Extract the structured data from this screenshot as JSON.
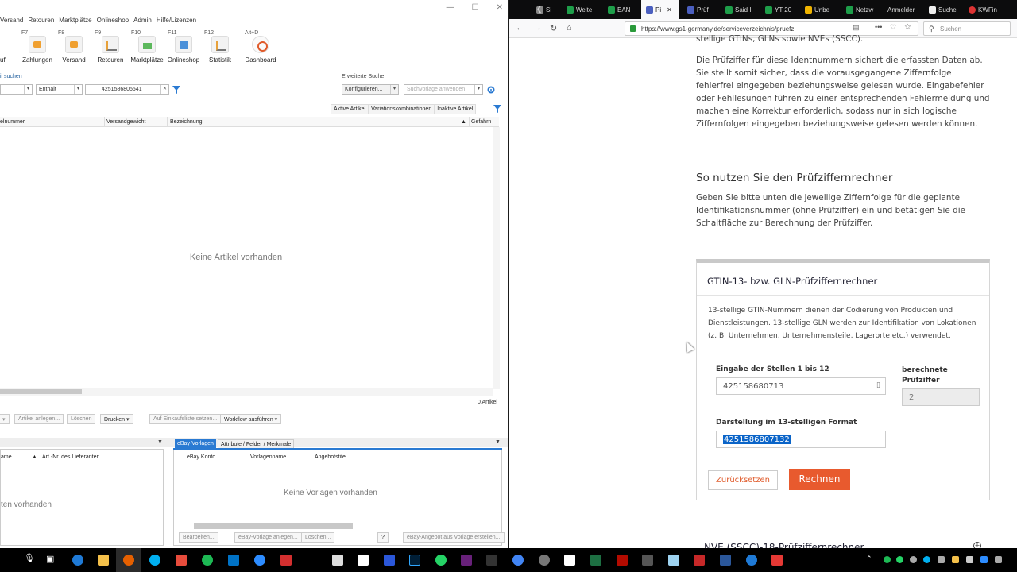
{
  "app": {
    "menu": [
      "Versand",
      "Retouren",
      "Marktplätze",
      "Onlineshop",
      "Admin",
      "Hilfe/Lizenzen"
    ],
    "ribbon": [
      {
        "key": "",
        "label": "uf"
      },
      {
        "key": "F7",
        "label": "Zahlungen"
      },
      {
        "key": "F8",
        "label": "Versand"
      },
      {
        "key": "F9",
        "label": "Retouren"
      },
      {
        "key": "F10",
        "label": "Marktplätze"
      },
      {
        "key": "F11",
        "label": "Onlineshop"
      },
      {
        "key": "F12",
        "label": "Statistik"
      },
      {
        "key": "Alt+D",
        "label": "Dashboard"
      }
    ],
    "search": {
      "label": "il suchen",
      "operator": "Enthält",
      "value": "4251586805541",
      "advanced_label": "Erweiterte Suche",
      "configure": "Konfigurieren...",
      "template_placeholder": "Suchvorlage anwenden"
    },
    "filter_tabs": [
      "Aktive Artikel",
      "Variationskombinationen",
      "Inaktive Artikel"
    ],
    "columns": [
      "elnummer",
      "Versandgewicht",
      "Bezeichnung",
      "Gefahrn"
    ],
    "empty_text": "Keine Artikel vorhanden",
    "count": "0 Artikel",
    "actions": [
      "Artikel anlegen...",
      "Löschen",
      "Drucken",
      "Auf Einkaufsliste setzen...",
      "Workflow ausführen"
    ],
    "lower_left": {
      "columns": [
        "ame",
        "Art.-Nr. des Lieferanten"
      ],
      "empty_text": "ten vorhanden"
    },
    "lower_right": {
      "tabs": [
        "eBay-Vorlagen",
        "Attribute / Felder / Merkmale"
      ],
      "columns": [
        "eBay Konto",
        "Vorlagenname",
        "Angebotstitel"
      ],
      "empty_text": "Keine Vorlagen vorhanden",
      "actions": [
        "Bearbeiten...",
        "eBay-Vorlage anlegen...",
        "Löschen...",
        "?",
        "eBay-Angebot aus Vorlage erstellen..."
      ]
    }
  },
  "browser": {
    "tabs": [
      {
        "label": "Si",
        "color": "#888"
      },
      {
        "label": "Weite",
        "color": "#1e9e4a"
      },
      {
        "label": "EAN",
        "color": "#1e9e4a"
      },
      {
        "label": "Pi",
        "color": "#4b5fbf"
      },
      {
        "label": "Prüf",
        "color": "#4b5fbf"
      },
      {
        "label": "Said I",
        "color": "#1e9e4a"
      },
      {
        "label": "YT 20",
        "color": "#1e9e4a"
      },
      {
        "label": "Unbe",
        "color": "#f0b400"
      },
      {
        "label": "Netzw",
        "color": "#1e9e4a"
      },
      {
        "label": "Anmelder",
        "color": "#888"
      },
      {
        "label": "Suche",
        "color": "#eee"
      },
      {
        "label": "KWFin",
        "color": "#d33"
      }
    ],
    "url": "https://www.gs1-germany.de/serviceverzeichnis/pruefz",
    "search_placeholder": "Suchen"
  },
  "page": {
    "top_fragment": "stellige GTINs, GLNs sowie NVEs (SSCC).",
    "intro": "Die Prüfziffer für diese Identnummern sichert die erfassten Daten ab. Sie stellt somit sicher, dass die vorausgegangene Ziffernfolge fehlerfrei eingegeben beziehungsweise gelesen wurde. Eingabefehler oder Fehllesungen führen zu einer entsprechenden Fehlermeldung und machen eine Korrektur erforderlich, sodass nur in sich logische Ziffernfolgen eingegeben beziehungsweise gelesen werden können.",
    "howto_title": "So nutzen Sie den Prüfziffernrechner",
    "howto_text": "Geben Sie bitte unten die jeweilige Ziffernfolge für die geplante Identifikationsnummer (ohne Prüfziffer) ein und betätigen Sie die Schaltfläche zur Berechnung der Prüfziffer.",
    "calc": {
      "title": "GTIN-13- bzw. GLN-Prüfziffernrechner",
      "description": "13-stellige GTIN-Nummern dienen der Codierung von Produkten und Dienstleistungen. 13-stellige GLN werden zur Identifikation von Lokationen (z. B. Unternehmen, Unternehmensteile, Lagerorte etc.) verwendet.",
      "input_label": "Eingabe der Stellen 1 bis 12",
      "input_value": "425158680713",
      "check_label": "berechnete Prüfziffer",
      "check_value": "2",
      "format_label": "Darstellung im 13-stelligen Format",
      "format_value": "4251586807132",
      "reset": "Zurücksetzen",
      "calc": "Rechnen"
    },
    "next_title": "NVE (SSCC)-18-Prüfziffernrechner"
  }
}
